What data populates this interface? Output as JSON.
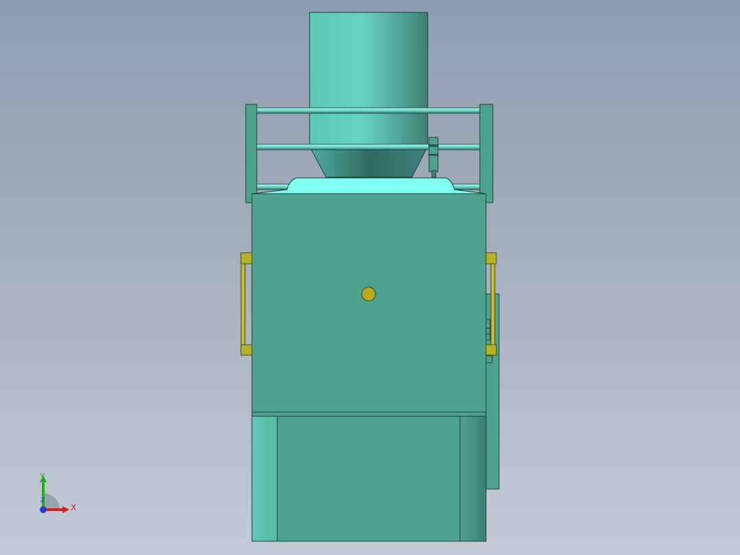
{
  "scene": {
    "background_top": "#8d9cb0",
    "background_bottom": "#c5cbd6",
    "body_color": "#4ea38f",
    "hopper_color": "#5fcbb4",
    "lid_color": "#7ffff0",
    "handle_color": "#b6b22a",
    "indicator_color": "#b6ac1e"
  },
  "triad": {
    "x_label": "X",
    "y_label": "Y",
    "z_label": "Z",
    "x_color": "#d02020",
    "y_color": "#20b020",
    "z_color": "#1f3fd0"
  }
}
